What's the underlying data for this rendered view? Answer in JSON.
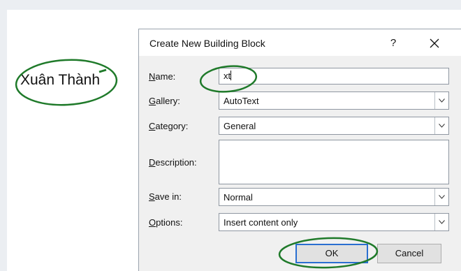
{
  "document": {
    "text": "Xuân Thành"
  },
  "dialog": {
    "title": "Create New Building Block",
    "help_label": "?",
    "fields": {
      "name": {
        "label_u": "N",
        "label_rest": "ame:",
        "value": "xt"
      },
      "gallery": {
        "label_u": "G",
        "label_rest": "allery:",
        "value": "AutoText"
      },
      "category": {
        "label_u": "C",
        "label_rest": "ategory:",
        "value": "General"
      },
      "description": {
        "label_u": "D",
        "label_rest": "escription:",
        "value": ""
      },
      "save_in": {
        "label_u": "S",
        "label_rest": "ave in:",
        "value": "Normal"
      },
      "options": {
        "label_u": "O",
        "label_rest": "ptions:",
        "value": "Insert content only"
      }
    },
    "buttons": {
      "ok": "OK",
      "cancel": "Cancel"
    }
  },
  "colors": {
    "annotation_green": "#1f7a2a",
    "ok_focus_border": "#2a6fd1",
    "dialog_bg": "#f0f0f0"
  },
  "icons": {
    "close": "close-icon",
    "dropdown": "chevron-down-icon"
  }
}
